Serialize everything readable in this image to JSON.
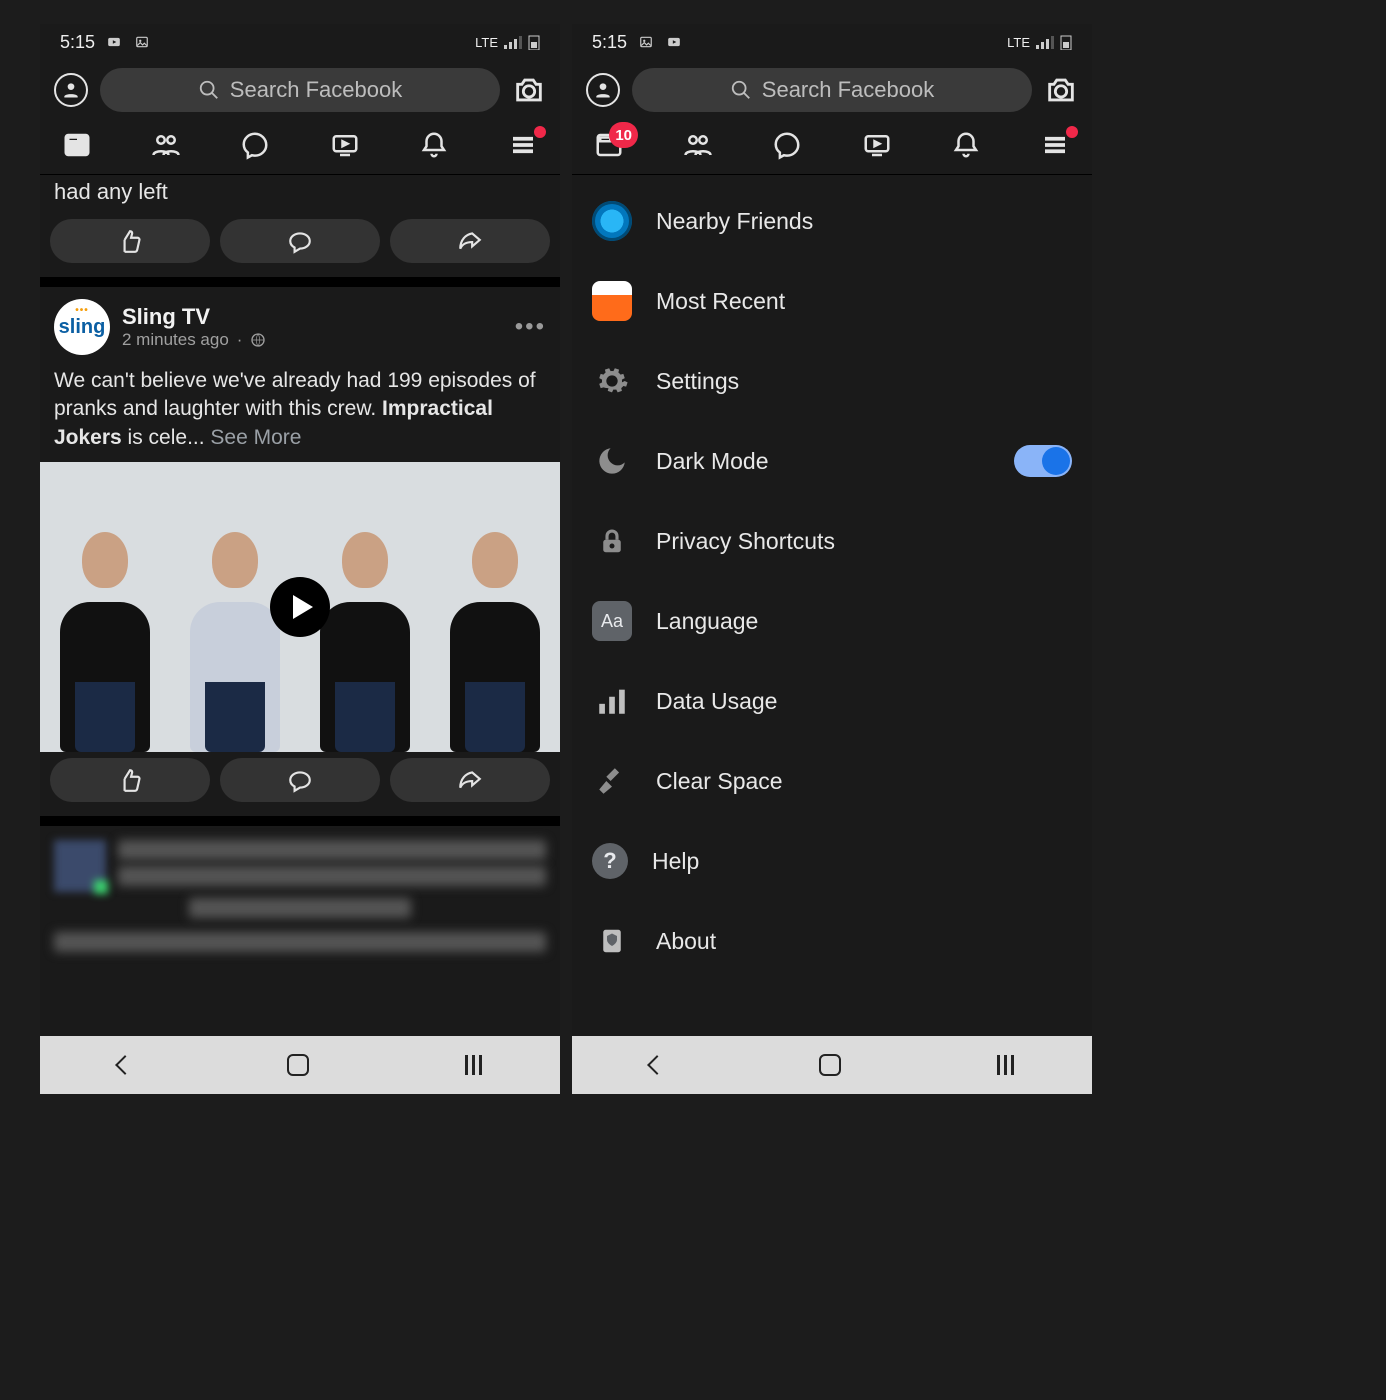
{
  "status": {
    "time": "5:15",
    "network": "LTE"
  },
  "search": {
    "placeholder": "Search Facebook"
  },
  "left": {
    "badge_menu_dot": true,
    "remnant_text": "had any left",
    "post": {
      "author": "Sling TV",
      "logo_text": "sling",
      "time": "2 minutes ago",
      "privacy": "public",
      "body_prefix": "We can't believe we've already had 199 episodes of pranks and laughter with this crew. ",
      "body_bold": "Impractical Jokers",
      "body_suffix": " is cele... ",
      "see_more": "See More"
    }
  },
  "right": {
    "feed_badge": "10",
    "menu": [
      {
        "key": "nearby",
        "label": "Nearby Friends"
      },
      {
        "key": "recent",
        "label": "Most Recent"
      },
      {
        "key": "settings",
        "label": "Settings"
      },
      {
        "key": "dark",
        "label": "Dark Mode",
        "toggle": true
      },
      {
        "key": "privacy",
        "label": "Privacy Shortcuts"
      },
      {
        "key": "lang",
        "label": "Language",
        "icon_text": "Aa"
      },
      {
        "key": "data",
        "label": "Data Usage"
      },
      {
        "key": "clear",
        "label": "Clear Space"
      },
      {
        "key": "help",
        "label": "Help",
        "icon_text": "?"
      },
      {
        "key": "about",
        "label": "About"
      }
    ]
  }
}
